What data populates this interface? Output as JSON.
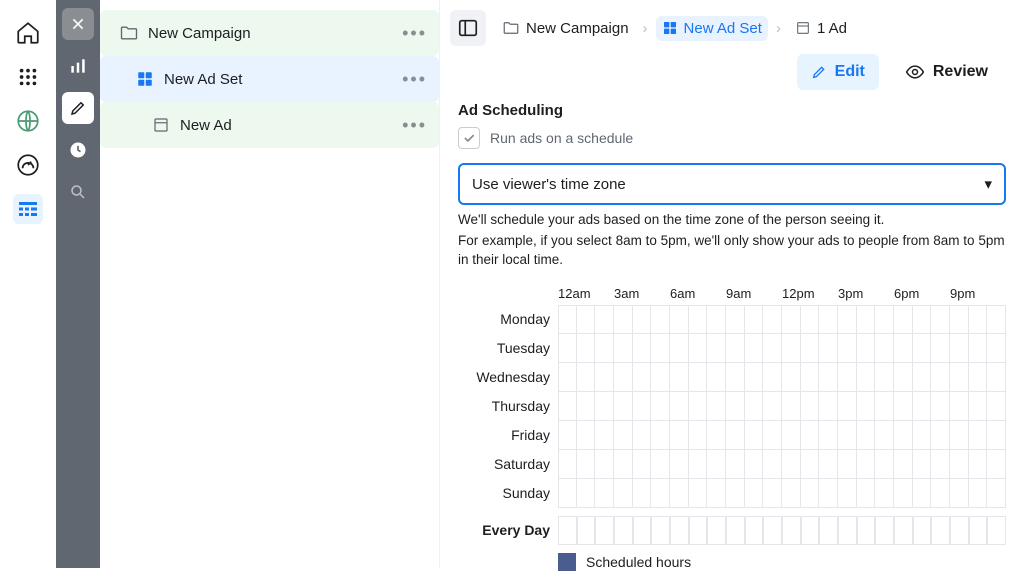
{
  "tree": {
    "campaign": "New Campaign",
    "adset": "New Ad Set",
    "ad": "New Ad"
  },
  "crumbs": {
    "campaign": "New Campaign",
    "adset": "New Ad Set",
    "ad_count": "1 Ad"
  },
  "actions": {
    "edit": "Edit",
    "review": "Review"
  },
  "section": {
    "title": "Ad Scheduling",
    "checkbox_label": "Run ads on a schedule",
    "select_value": "Use viewer's time zone",
    "help1": "We'll schedule your ads based on the time zone of the person seeing it.",
    "help2": "For example, if you select 8am to 5pm, we'll only show your ads to people from 8am to 5pm in their local time."
  },
  "schedule": {
    "hours": [
      "12am",
      "3am",
      "6am",
      "9am",
      "12pm",
      "3pm",
      "6pm",
      "9pm"
    ],
    "days": [
      "Monday",
      "Tuesday",
      "Wednesday",
      "Thursday",
      "Friday",
      "Saturday",
      "Sunday"
    ],
    "every_day_label": "Every Day",
    "legend": "Scheduled hours"
  }
}
